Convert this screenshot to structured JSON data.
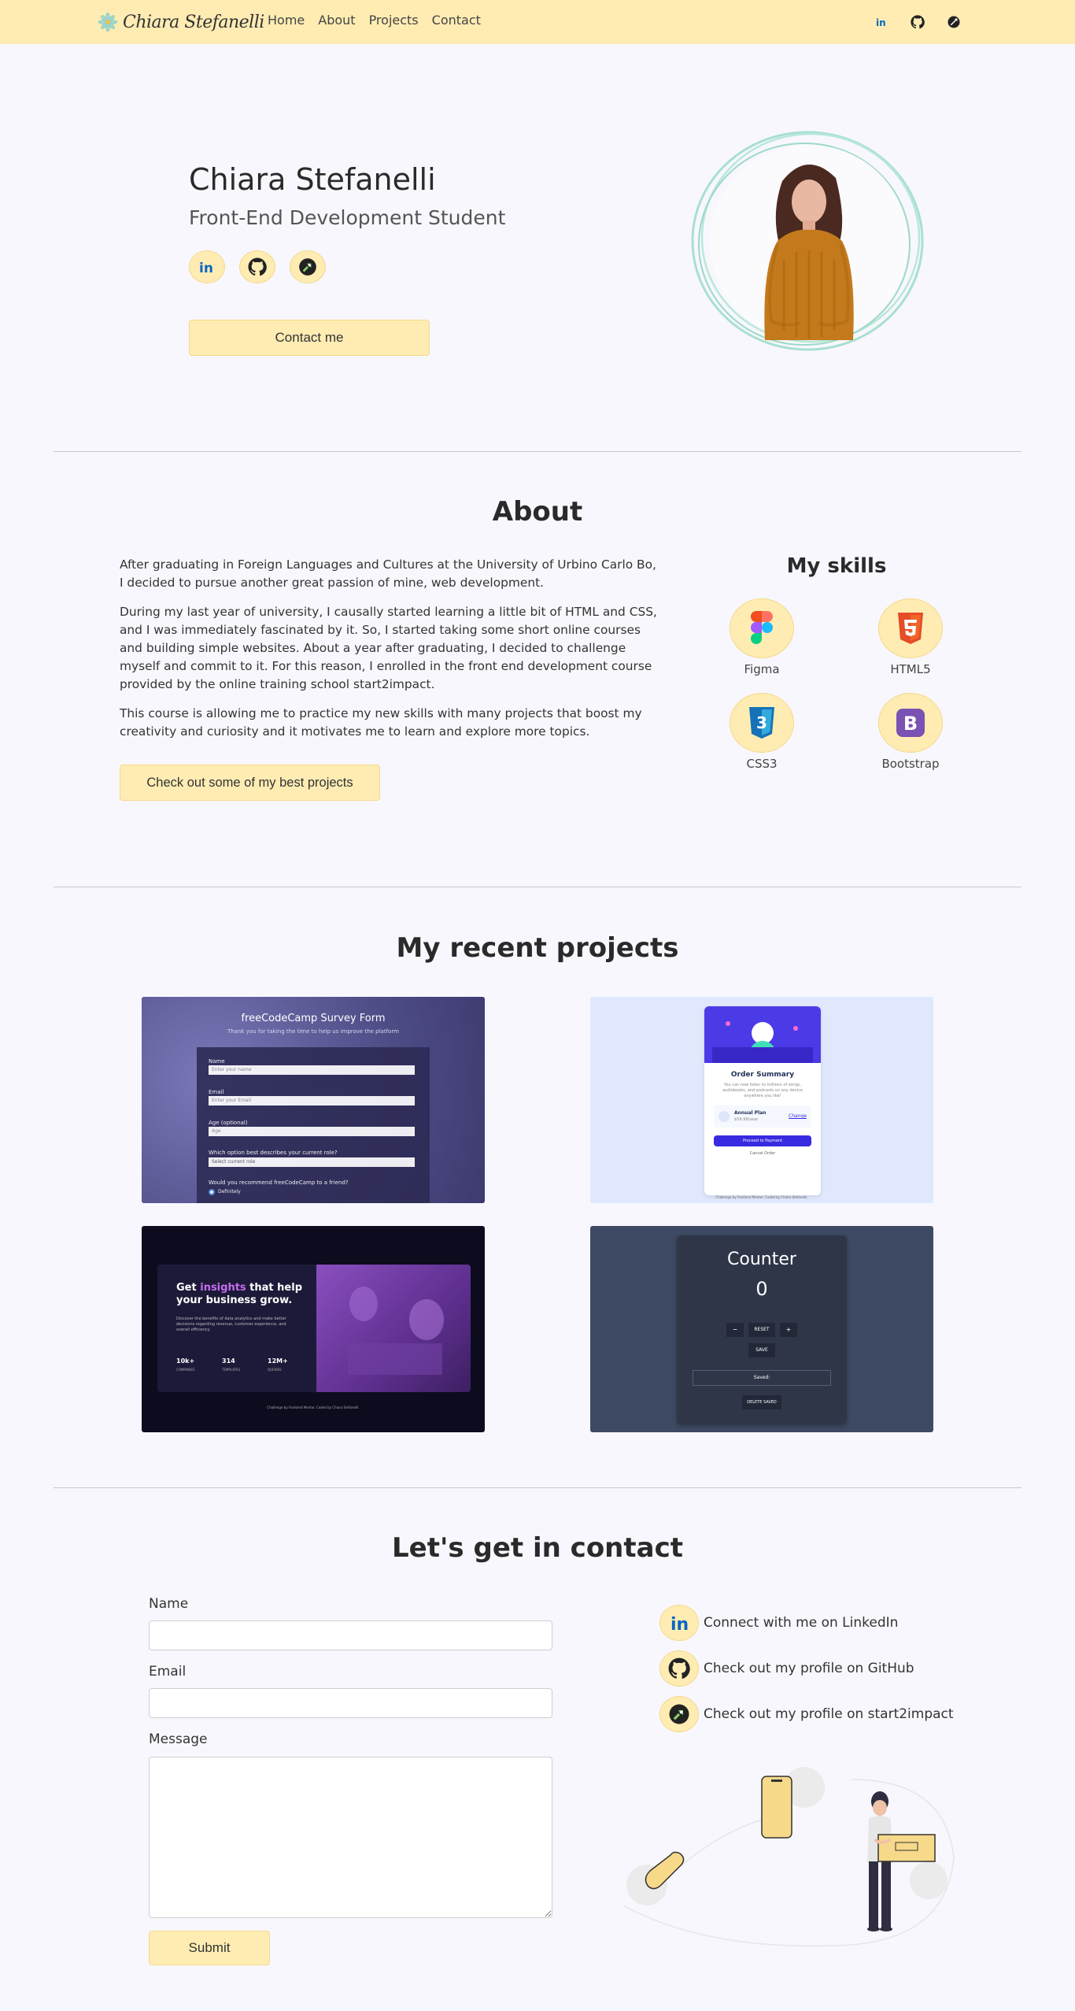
{
  "nav": {
    "brand": "Chiara Stefanelli",
    "links": [
      "Home",
      "About",
      "Projects",
      "Contact"
    ],
    "icons": [
      "linkedin-icon",
      "github-icon",
      "start2impact-icon"
    ]
  },
  "hero": {
    "name": "Chiara Stefanelli",
    "subtitle": "Front-End Development Student",
    "button": "Contact me"
  },
  "about": {
    "title": "About",
    "paragraphs": [
      "After graduating in Foreign Languages and Cultures at the University of Urbino Carlo Bo, I decided to pursue another great passion of mine, web development.",
      "During my last year of university, I causally started learning a little bit of HTML and CSS, and I was immediately fascinated by it. So, I started taking some short online courses and building simple websites. About a year after graduating, I decided to challenge myself and commit to it. For this reason, I enrolled in the front end development course provided by the online training school start2impact.",
      "This course is allowing me to practice my new skills with many projects that boost my creativity and curiosity and it motivates me to learn and explore more topics."
    ],
    "button": "Check out some of my best projects",
    "skills_title": "My skills",
    "skills": [
      "Figma",
      "HTML5",
      "CSS3",
      "Bootstrap"
    ]
  },
  "projects": {
    "title": "My recent projects",
    "survey": {
      "title": "freeCodeCamp Survey Form",
      "subtitle": "Thank you for taking the time to help us improve the platform",
      "name_label": "Name",
      "name_placeholder": "Enter your name",
      "email_label": "Email",
      "email_placeholder": "Enter your Email",
      "age_label": "Age (optional)",
      "age_placeholder": "Age",
      "select_label": "Which option best describes your current role?",
      "select_value": "Select current role",
      "recommend_label": "Would you recommend freeCodeCamp to a friend?",
      "radio_label": "Definitely"
    },
    "order": {
      "title": "Order Summary",
      "text": "You can now listen to millions of songs, audiobooks, and podcasts on any device anywhere you like!",
      "plan": "Annual Plan",
      "price": "$59.99/year",
      "change": "Change",
      "pay": "Proceed to Payment",
      "cancel": "Cancel Order",
      "credit": "Challenge by Frontend Mentor. Coded by Chiara Stefanelli."
    },
    "insights": {
      "title_pre": "Get ",
      "title_accent": "insights",
      "title_post": " that help your business grow.",
      "text": "Discover the benefits of data analytics and make better decisions regarding revenue, customer experience, and overall efficiency.",
      "stats": [
        {
          "value": "10k+",
          "label": "COMPANIES"
        },
        {
          "value": "314",
          "label": "TEMPLATES"
        },
        {
          "value": "12M+",
          "label": "QUERIES"
        }
      ],
      "credit": "Challenge by Frontend Mentor. Coded by Chiara Stefanelli."
    },
    "counter": {
      "title": "Counter",
      "value": "0",
      "minus": "−",
      "reset": "RESET",
      "plus": "+",
      "save": "SAVE",
      "saved": "Saved:",
      "delete": "DELETE SAVED"
    }
  },
  "contact": {
    "title": "Let's get in contact",
    "name_label": "Name",
    "email_label": "Email",
    "message_label": "Message",
    "submit": "Submit",
    "links": [
      {
        "label": "Connect with me on LinkedIn",
        "icon": "linkedin-icon"
      },
      {
        "label": "Check out my profile on GitHub",
        "icon": "github-icon"
      },
      {
        "label": "Check out my profile on start2impact",
        "icon": "start2impact-icon"
      }
    ]
  },
  "colors": {
    "accent": "#feecb3",
    "background": "#f8f7fd",
    "linkedin": "#0a66c2",
    "circle": "#a8e0d0"
  }
}
